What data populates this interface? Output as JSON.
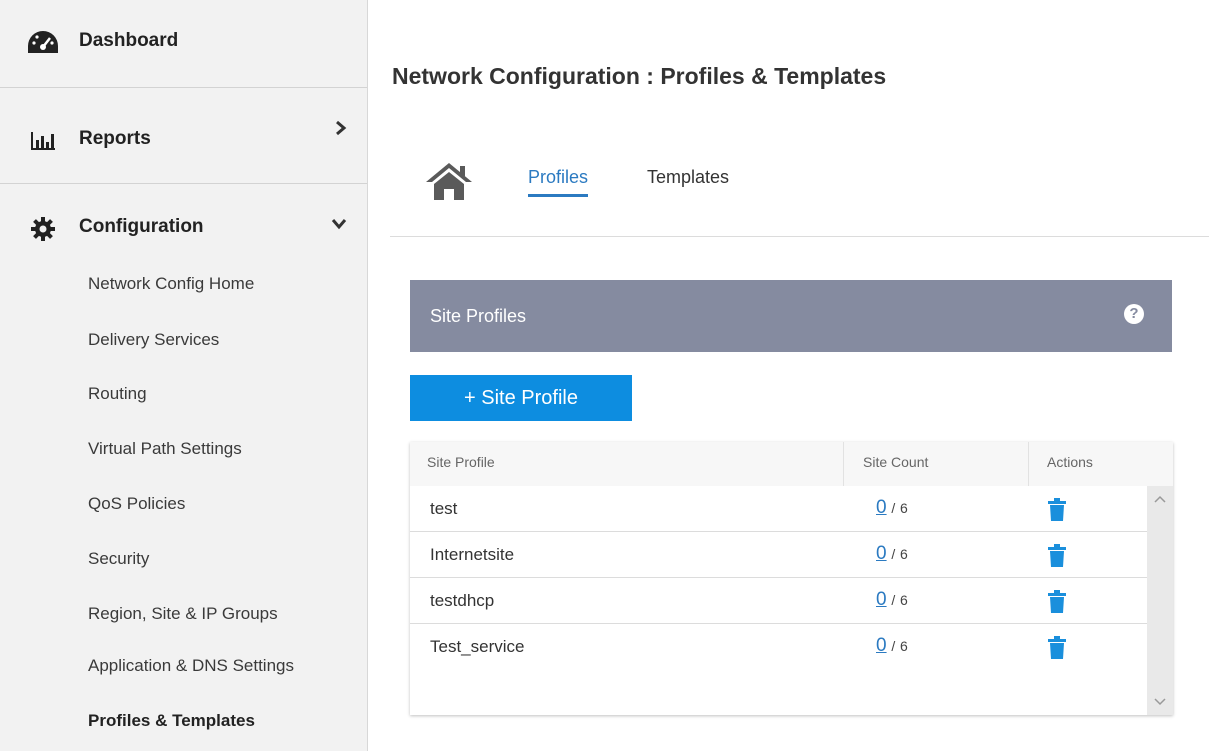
{
  "sidebar": {
    "dashboard": "Dashboard",
    "reports": "Reports",
    "configuration": "Configuration",
    "sub_items": [
      "Network Config Home",
      "Delivery Services",
      "Routing",
      "Virtual Path Settings",
      "QoS Policies",
      "Security",
      "Region, Site & IP Groups",
      "Application & DNS Settings",
      "Profiles & Templates"
    ],
    "active_item": "Profiles & Templates",
    "icons": {
      "dashboard": "speedometer-icon",
      "reports": "bar-chart-icon",
      "configuration": "gear-icon"
    }
  },
  "header": {
    "title": "Network Configuration : Profiles & Templates"
  },
  "tabs": {
    "profiles": "Profiles",
    "templates": "Templates",
    "active": "Profiles"
  },
  "panel": {
    "title": "Site Profiles",
    "add_button": "+ Site Profile"
  },
  "table": {
    "columns": [
      "Site Profile",
      "Site Count",
      "Actions"
    ],
    "rows": [
      {
        "name": "test",
        "count": "0",
        "total": "6"
      },
      {
        "name": "Internetsite",
        "count": "0",
        "total": "6"
      },
      {
        "name": "testdhcp",
        "count": "0",
        "total": "6"
      },
      {
        "name": "Test_service",
        "count": "0",
        "total": "6"
      }
    ],
    "separator": "/"
  },
  "colors": {
    "accent": "#2b7ac1",
    "button": "#0d8de0",
    "panel_header": "#858ba0",
    "sidebar_bg": "#f2f2f2"
  }
}
